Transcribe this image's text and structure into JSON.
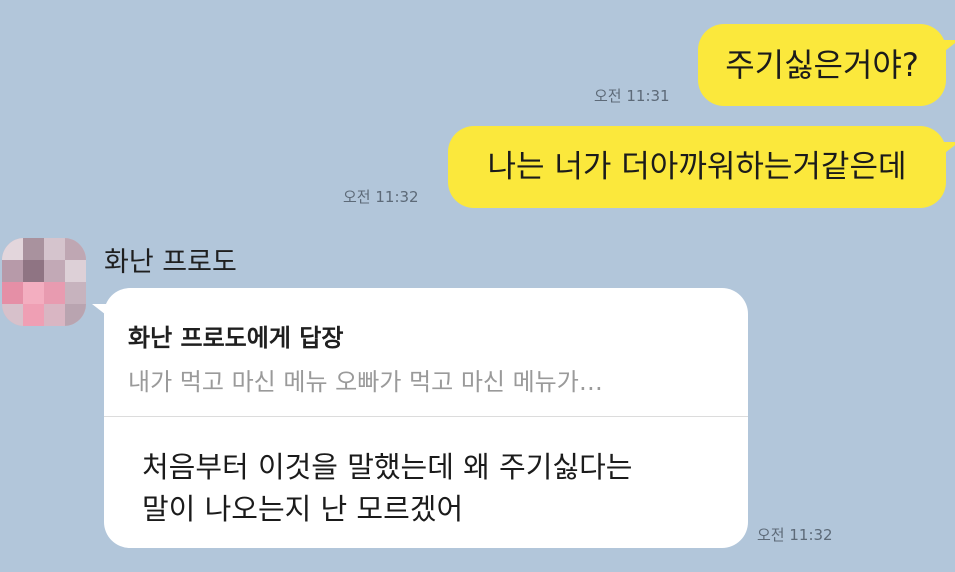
{
  "conversation": {
    "messages": [
      {
        "sender": "me",
        "text": "주기싫은거야?",
        "time": "오전 11:31"
      },
      {
        "sender": "me",
        "text": "나는 너가 더아까워하는거같은데",
        "time": "오전 11:32"
      }
    ],
    "reply": {
      "sender_name": "화난 프로도",
      "quote_title": "화난 프로도에게 답장",
      "quote_text": "내가 먹고 마신 메뉴 오빠가 먹고 마신 메뉴가…",
      "text_line1": "처음부터 이것을 말했는데 왜 주기싫다는",
      "text_line2": "말이 나오는지 난 모르겠어",
      "time": "오전 11:32"
    }
  },
  "colors": {
    "background": "#b2c6da",
    "my_bubble": "#fbe83c",
    "their_bubble": "#ffffff"
  }
}
